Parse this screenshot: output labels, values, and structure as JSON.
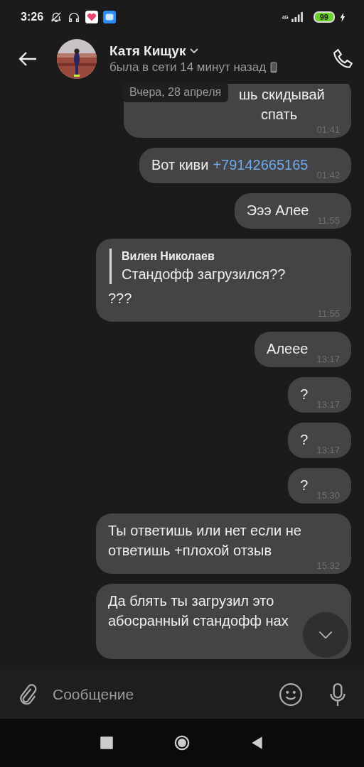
{
  "status_bar": {
    "time": "3:26",
    "network": "4G",
    "battery": "99"
  },
  "header": {
    "name": "Катя Кищук",
    "status": "была в сети 14 минут назад"
  },
  "date_pill": "Вчера, 28 апреля",
  "messages": [
    {
      "lines": [
        "шь скидывай",
        "спать"
      ],
      "time": "01:41"
    },
    {
      "lines": [
        "Вот киви"
      ],
      "link": "+79142665165",
      "time": "01:42"
    },
    {
      "lines": [
        "Эээ Алее"
      ],
      "time": "11:55"
    },
    {
      "quote": {
        "author": "Вилен Николаев",
        "text": "Стандофф загрузился??"
      },
      "lines": [
        "???"
      ],
      "time": "11:55"
    },
    {
      "lines": [
        "Алеее"
      ],
      "time": "13:17"
    },
    {
      "lines": [
        "?"
      ],
      "time": "13:17"
    },
    {
      "lines": [
        "?"
      ],
      "time": "13:17"
    },
    {
      "lines": [
        "?"
      ],
      "time": "15:30"
    },
    {
      "lines": [
        "Ты ответишь или нет если не",
        "ответишь +плохой отзыв"
      ],
      "time": "15:32"
    },
    {
      "lines": [
        "Да блять ты загрузил это",
        "абосранный стандофф нах"
      ]
    }
  ],
  "composer": {
    "placeholder": "Сообщение"
  }
}
